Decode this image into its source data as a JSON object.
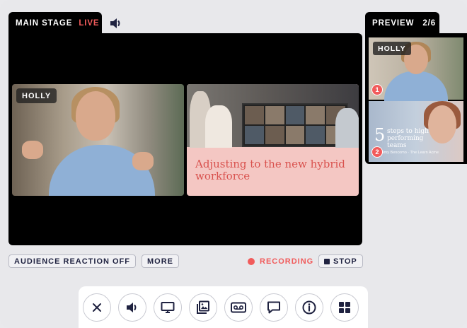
{
  "stage": {
    "title": "MAIN STAGE",
    "status": "LIVE",
    "tiles": [
      {
        "label": "HOLLY"
      },
      {
        "slide_title": "Adjusting to the new hybrid workforce"
      }
    ]
  },
  "preview": {
    "title": "PREVIEW",
    "count": "2/6",
    "items": [
      {
        "label": "HOLLY",
        "number": "1"
      },
      {
        "number": "2",
        "big_number": "5",
        "text": "steps to high performing teams",
        "credit": "Amy Bencomo · The Learn Acme"
      }
    ]
  },
  "controls": {
    "audience_reaction": "AUDIENCE REACTION OFF",
    "more": "MORE",
    "recording": "RECORDING",
    "stop": "STOP"
  },
  "toolbar": {
    "buttons": [
      "close-icon",
      "speaker-icon",
      "screen-share-icon",
      "media-icon",
      "voicemail-icon",
      "chat-icon",
      "info-icon",
      "grid-icon"
    ]
  },
  "colors": {
    "live": "#f15b5b",
    "accent_dark": "#1f2240",
    "slide_bg": "#f4c7c3",
    "slide_text": "#d9524e"
  }
}
